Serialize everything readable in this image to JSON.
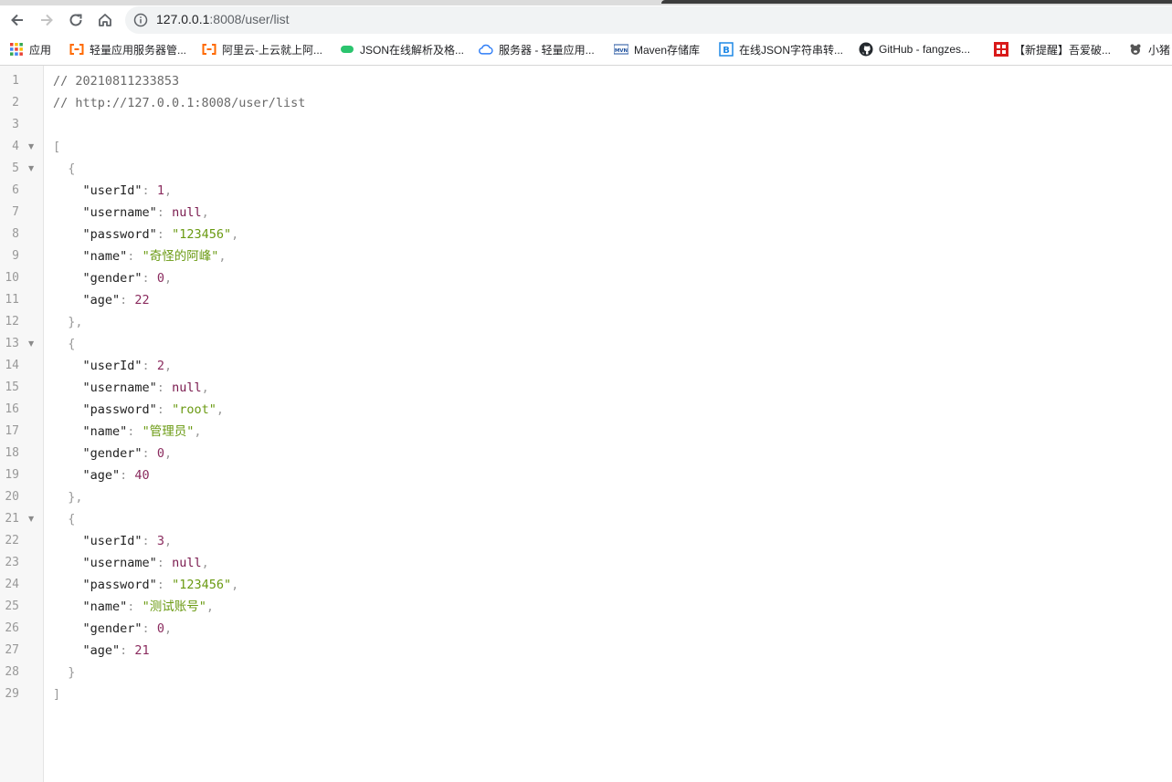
{
  "browser": {
    "url_host": "127.0.0.1",
    "url_path": ":8008/user/list"
  },
  "bookmarks": [
    {
      "label": "应用",
      "icon": "apps-grid-icon"
    },
    {
      "label": "轻量应用服务器管...",
      "icon": "aliyun-icon"
    },
    {
      "label": "阿里云-上云就上阿...",
      "icon": "aliyun-icon"
    },
    {
      "label": "JSON在线解析及格...",
      "icon": "json-icon"
    },
    {
      "label": "服务器 - 轻量应用...",
      "icon": "cloud-icon"
    },
    {
      "label": "Maven存储库",
      "icon": "maven-icon"
    },
    {
      "label": "在线JSON字符串转...",
      "icon": "bejson-icon"
    },
    {
      "label": "GitHub - fangzes...",
      "icon": "github-icon"
    },
    {
      "label": "【新提醒】吾爱破...",
      "icon": "52pojie-icon"
    },
    {
      "label": "小猪",
      "icon": "pig-icon"
    }
  ],
  "viewer": {
    "comment_timestamp": "// 20210811233853",
    "comment_url": "// http://127.0.0.1:8008/user/list",
    "users": [
      {
        "userId": "1",
        "username": "null",
        "password": "\"123456\"",
        "name": "\"奇怪的阿峰\"",
        "gender": "0",
        "age": "22"
      },
      {
        "userId": "2",
        "username": "null",
        "password": "\"root\"",
        "name": "\"管理员\"",
        "gender": "0",
        "age": "40"
      },
      {
        "userId": "3",
        "username": "null",
        "password": "\"123456\"",
        "name": "\"测试账号\"",
        "gender": "0",
        "age": "21"
      }
    ]
  },
  "colors": {
    "string": "#6a9a12",
    "number": "#8a2b5e",
    "line_number": "#999999"
  }
}
